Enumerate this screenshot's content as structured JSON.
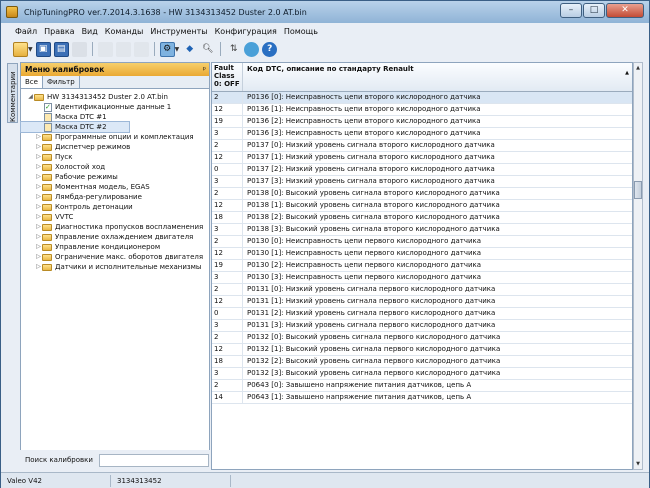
{
  "window": {
    "title": "ChipTuningPRO ver.7.2014.3.1638 - HW 3134313452 Duster 2.0 AT.bin",
    "minimize": "–",
    "maximize": "□",
    "close": "✕"
  },
  "menu": [
    "Файл",
    "Правка",
    "Вид",
    "Команды",
    "Инструменты",
    "Конфигурация",
    "Помощь"
  ],
  "side_tab": "Комментарии",
  "left_panel": {
    "title": "Меню калибровок",
    "pin": "ᵖ",
    "tabs": [
      "Все",
      "Фильтр"
    ],
    "root": "HW 3134313452 Duster 2.0 AT.bin",
    "items": [
      {
        "label": "Идентификационные данные 1",
        "icon": "check"
      },
      {
        "label": "Маска DTC #1",
        "icon": "mask"
      },
      {
        "label": "Маска DTC #2",
        "icon": "mask",
        "selected": true
      }
    ],
    "folders": [
      "Программные опции и комплектация",
      "Диспетчер режимов",
      "Пуск",
      "Холостой ход",
      "Рабочие режимы",
      "Моментная модель, EGAS",
      "Лямбда-регулирование",
      "Контроль детонации",
      "VVTC",
      "Диагностика пропусков воспламенения",
      "Управление охлаждением двигателя",
      "Управление кондиционером",
      "Ограничение макс. оборотов двигателя",
      "Датчики и исполнительные механизмы"
    ],
    "search_label": "Поиск калибровки",
    "search_value": ""
  },
  "grid": {
    "col1_header": "Fault Class 0: OFF",
    "col2_header": "Код DTC, описание по стандарту Renault",
    "rows": [
      {
        "c": "2",
        "d": "P0136 [0]: Неисправность цепи второго кислородного датчика"
      },
      {
        "c": "12",
        "d": "P0136 [1]: Неисправность цепи второго кислородного датчика"
      },
      {
        "c": "19",
        "d": "P0136 [2]: Неисправность цепи второго кислородного датчика"
      },
      {
        "c": "3",
        "d": "P0136 [3]: Неисправность цепи второго кислородного датчика"
      },
      {
        "c": "2",
        "d": "P0137 [0]: Низкий уровень сигнала второго кислородного датчика"
      },
      {
        "c": "12",
        "d": "P0137 [1]: Низкий уровень сигнала второго кислородного датчика"
      },
      {
        "c": "0",
        "d": "P0137 [2]: Низкий уровень сигнала второго кислородного датчика"
      },
      {
        "c": "3",
        "d": "P0137 [3]: Низкий уровень сигнала второго кислородного датчика"
      },
      {
        "c": "2",
        "d": "P0138 [0]: Высокий уровень сигнала второго кислородного датчика"
      },
      {
        "c": "12",
        "d": "P0138 [1]: Высокий уровень сигнала второго кислородного датчика"
      },
      {
        "c": "18",
        "d": "P0138 [2]: Высокий уровень сигнала второго кислородного датчика"
      },
      {
        "c": "3",
        "d": "P0138 [3]: Высокий уровень сигнала второго кислородного датчика"
      },
      {
        "c": "2",
        "d": "P0130 [0]: Неисправность цепи первого кислородного датчика"
      },
      {
        "c": "12",
        "d": "P0130 [1]: Неисправность цепи первого кислородного датчика"
      },
      {
        "c": "19",
        "d": "P0130 [2]: Неисправность цепи первого кислородного датчика"
      },
      {
        "c": "3",
        "d": "P0130 [3]: Неисправность цепи первого кислородного датчика"
      },
      {
        "c": "2",
        "d": "P0131 [0]: Низкий уровень сигнала первого кислородного датчика"
      },
      {
        "c": "12",
        "d": "P0131 [1]: Низкий уровень сигнала первого кислородного датчика"
      },
      {
        "c": "0",
        "d": "P0131 [2]: Низкий уровень сигнала первого кислородного датчика"
      },
      {
        "c": "3",
        "d": "P0131 [3]: Низкий уровень сигнала первого кислородного датчика"
      },
      {
        "c": "2",
        "d": "P0132 [0]: Высокий уровень сигнала первого кислородного датчика"
      },
      {
        "c": "12",
        "d": "P0132 [1]: Высокий уровень сигнала первого кислородного датчика"
      },
      {
        "c": "18",
        "d": "P0132 [2]: Высокий уровень сигнала первого кислородного датчика"
      },
      {
        "c": "3",
        "d": "P0132 [3]: Высокий уровень сигнала первого кислородного датчика"
      },
      {
        "c": "2",
        "d": "P0643 [0]: Завышено напряжение питания датчиков, цепь A"
      },
      {
        "c": "14",
        "d": "P0643 [1]: Завышено напряжение питания датчиков, цепь A"
      }
    ]
  },
  "status": {
    "left": "Valeo V42",
    "middle": "3134313452"
  }
}
